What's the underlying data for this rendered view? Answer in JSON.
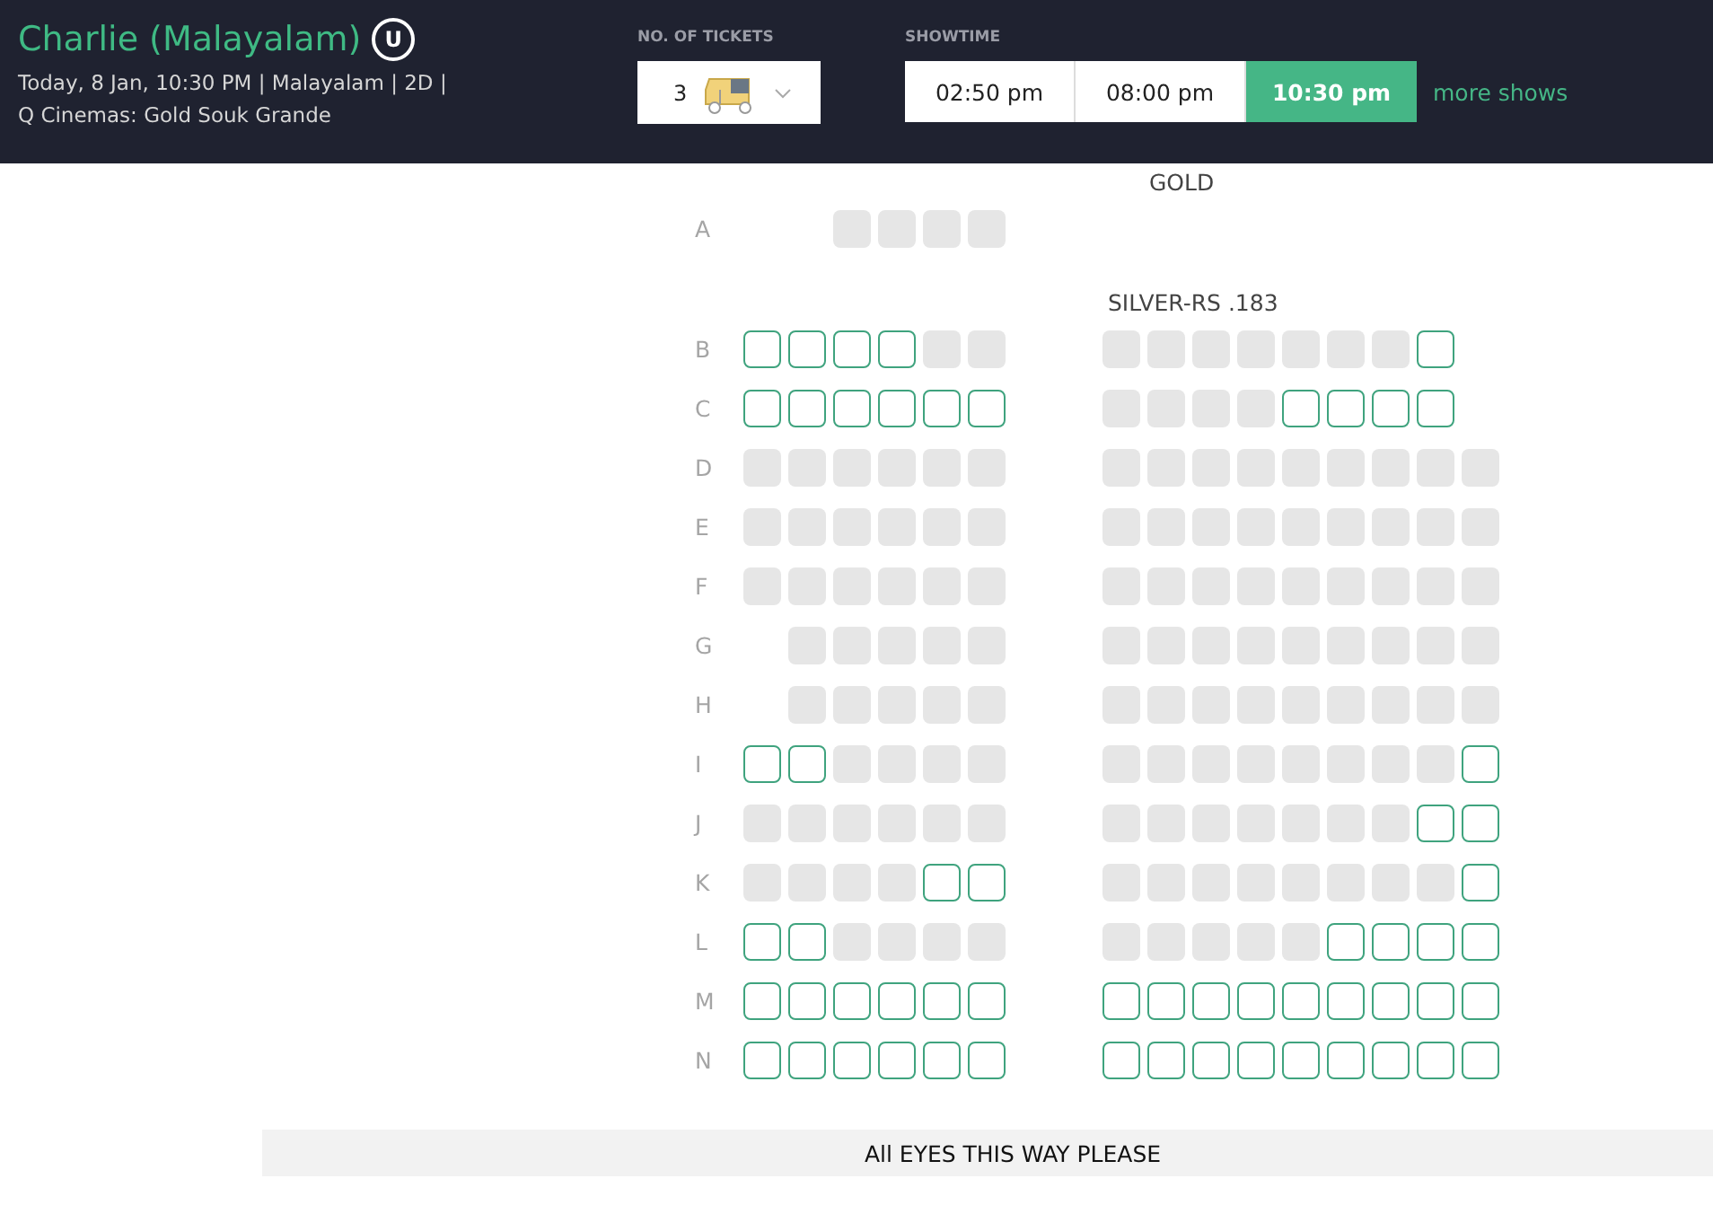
{
  "movie": {
    "title": "Charlie (Malayalam)",
    "certificate": "U",
    "details": "Today, 8 Jan, 10:30 PM | Malayalam | 2D |",
    "cinema": "Q Cinemas: Gold Souk Grande"
  },
  "tickets": {
    "label": "NO. OF TICKETS",
    "value": "3"
  },
  "showtime": {
    "label": "SHOWTIME",
    "times": [
      {
        "label": "02:50 pm",
        "selected": false
      },
      {
        "label": "08:00 pm",
        "selected": false
      },
      {
        "label": "10:30 pm",
        "selected": true
      }
    ],
    "more": "more shows"
  },
  "sections": [
    {
      "title": "GOLD",
      "rows": [
        {
          "label": "A",
          "left": [
            {
              "kind": "gap"
            },
            {
              "kind": "gap"
            },
            {
              "kind": "sold"
            },
            {
              "kind": "sold"
            },
            {
              "kind": "sold"
            },
            {
              "kind": "sold"
            }
          ],
          "right": []
        }
      ]
    },
    {
      "title": "SILVER-RS .183",
      "rows": [
        {
          "label": "B",
          "left": [
            {
              "kind": "available"
            },
            {
              "kind": "available"
            },
            {
              "kind": "available"
            },
            {
              "kind": "available"
            },
            {
              "kind": "sold"
            },
            {
              "kind": "sold"
            }
          ],
          "right": [
            {
              "kind": "sold"
            },
            {
              "kind": "sold"
            },
            {
              "kind": "sold"
            },
            {
              "kind": "sold"
            },
            {
              "kind": "sold"
            },
            {
              "kind": "sold"
            },
            {
              "kind": "sold"
            },
            {
              "kind": "available"
            }
          ]
        },
        {
          "label": "C",
          "left": [
            {
              "kind": "available"
            },
            {
              "kind": "available"
            },
            {
              "kind": "available"
            },
            {
              "kind": "available"
            },
            {
              "kind": "available"
            },
            {
              "kind": "available"
            }
          ],
          "right": [
            {
              "kind": "sold"
            },
            {
              "kind": "sold"
            },
            {
              "kind": "sold"
            },
            {
              "kind": "sold"
            },
            {
              "kind": "available"
            },
            {
              "kind": "available"
            },
            {
              "kind": "available"
            },
            {
              "kind": "available"
            }
          ]
        },
        {
          "label": "D",
          "left": [
            {
              "kind": "sold"
            },
            {
              "kind": "sold"
            },
            {
              "kind": "sold"
            },
            {
              "kind": "sold"
            },
            {
              "kind": "sold"
            },
            {
              "kind": "sold"
            }
          ],
          "right": [
            {
              "kind": "sold"
            },
            {
              "kind": "sold"
            },
            {
              "kind": "sold"
            },
            {
              "kind": "sold"
            },
            {
              "kind": "sold"
            },
            {
              "kind": "sold"
            },
            {
              "kind": "sold"
            },
            {
              "kind": "sold"
            },
            {
              "kind": "sold"
            }
          ]
        },
        {
          "label": "E",
          "left": [
            {
              "kind": "sold"
            },
            {
              "kind": "sold"
            },
            {
              "kind": "sold"
            },
            {
              "kind": "sold"
            },
            {
              "kind": "sold"
            },
            {
              "kind": "sold"
            }
          ],
          "right": [
            {
              "kind": "sold"
            },
            {
              "kind": "sold"
            },
            {
              "kind": "sold"
            },
            {
              "kind": "sold"
            },
            {
              "kind": "sold"
            },
            {
              "kind": "sold"
            },
            {
              "kind": "sold"
            },
            {
              "kind": "sold"
            },
            {
              "kind": "sold"
            }
          ]
        },
        {
          "label": "F",
          "left": [
            {
              "kind": "sold"
            },
            {
              "kind": "sold"
            },
            {
              "kind": "sold"
            },
            {
              "kind": "sold"
            },
            {
              "kind": "sold"
            },
            {
              "kind": "sold"
            }
          ],
          "right": [
            {
              "kind": "sold"
            },
            {
              "kind": "sold"
            },
            {
              "kind": "sold"
            },
            {
              "kind": "sold"
            },
            {
              "kind": "sold"
            },
            {
              "kind": "sold"
            },
            {
              "kind": "sold"
            },
            {
              "kind": "sold"
            },
            {
              "kind": "sold"
            }
          ]
        },
        {
          "label": "G",
          "left": [
            {
              "kind": "gap"
            },
            {
              "kind": "sold"
            },
            {
              "kind": "sold"
            },
            {
              "kind": "sold"
            },
            {
              "kind": "sold"
            },
            {
              "kind": "sold"
            }
          ],
          "right": [
            {
              "kind": "sold"
            },
            {
              "kind": "sold"
            },
            {
              "kind": "sold"
            },
            {
              "kind": "sold"
            },
            {
              "kind": "sold"
            },
            {
              "kind": "sold"
            },
            {
              "kind": "sold"
            },
            {
              "kind": "sold"
            },
            {
              "kind": "sold"
            }
          ]
        },
        {
          "label": "H",
          "left": [
            {
              "kind": "gap"
            },
            {
              "kind": "sold"
            },
            {
              "kind": "sold"
            },
            {
              "kind": "sold"
            },
            {
              "kind": "sold"
            },
            {
              "kind": "sold"
            }
          ],
          "right": [
            {
              "kind": "sold"
            },
            {
              "kind": "sold"
            },
            {
              "kind": "sold"
            },
            {
              "kind": "sold"
            },
            {
              "kind": "sold"
            },
            {
              "kind": "sold"
            },
            {
              "kind": "sold"
            },
            {
              "kind": "sold"
            },
            {
              "kind": "sold"
            }
          ]
        },
        {
          "label": "I",
          "left": [
            {
              "kind": "available"
            },
            {
              "kind": "available"
            },
            {
              "kind": "sold"
            },
            {
              "kind": "sold"
            },
            {
              "kind": "sold"
            },
            {
              "kind": "sold"
            }
          ],
          "right": [
            {
              "kind": "sold"
            },
            {
              "kind": "sold"
            },
            {
              "kind": "sold"
            },
            {
              "kind": "sold"
            },
            {
              "kind": "sold"
            },
            {
              "kind": "sold"
            },
            {
              "kind": "sold"
            },
            {
              "kind": "sold"
            },
            {
              "kind": "available"
            }
          ]
        },
        {
          "label": "J",
          "left": [
            {
              "kind": "sold"
            },
            {
              "kind": "sold"
            },
            {
              "kind": "sold"
            },
            {
              "kind": "sold"
            },
            {
              "kind": "sold"
            },
            {
              "kind": "sold"
            }
          ],
          "right": [
            {
              "kind": "sold"
            },
            {
              "kind": "sold"
            },
            {
              "kind": "sold"
            },
            {
              "kind": "sold"
            },
            {
              "kind": "sold"
            },
            {
              "kind": "sold"
            },
            {
              "kind": "sold"
            },
            {
              "kind": "available"
            },
            {
              "kind": "available"
            }
          ]
        },
        {
          "label": "K",
          "left": [
            {
              "kind": "sold"
            },
            {
              "kind": "sold"
            },
            {
              "kind": "sold"
            },
            {
              "kind": "sold"
            },
            {
              "kind": "available"
            },
            {
              "kind": "available"
            }
          ],
          "right": [
            {
              "kind": "sold"
            },
            {
              "kind": "sold"
            },
            {
              "kind": "sold"
            },
            {
              "kind": "sold"
            },
            {
              "kind": "sold"
            },
            {
              "kind": "sold"
            },
            {
              "kind": "sold"
            },
            {
              "kind": "sold"
            },
            {
              "kind": "available"
            }
          ]
        },
        {
          "label": "L",
          "left": [
            {
              "kind": "available"
            },
            {
              "kind": "available"
            },
            {
              "kind": "sold"
            },
            {
              "kind": "sold"
            },
            {
              "kind": "sold"
            },
            {
              "kind": "sold"
            }
          ],
          "right": [
            {
              "kind": "sold"
            },
            {
              "kind": "sold"
            },
            {
              "kind": "sold"
            },
            {
              "kind": "sold"
            },
            {
              "kind": "sold"
            },
            {
              "kind": "available"
            },
            {
              "kind": "available"
            },
            {
              "kind": "available"
            },
            {
              "kind": "available"
            }
          ]
        },
        {
          "label": "M",
          "left": [
            {
              "kind": "available"
            },
            {
              "kind": "available"
            },
            {
              "kind": "available"
            },
            {
              "kind": "available"
            },
            {
              "kind": "available"
            },
            {
              "kind": "available"
            }
          ],
          "right": [
            {
              "kind": "available"
            },
            {
              "kind": "available"
            },
            {
              "kind": "available"
            },
            {
              "kind": "available"
            },
            {
              "kind": "available"
            },
            {
              "kind": "available"
            },
            {
              "kind": "available"
            },
            {
              "kind": "available"
            },
            {
              "kind": "available"
            }
          ]
        },
        {
          "label": "N",
          "left": [
            {
              "kind": "available"
            },
            {
              "kind": "available"
            },
            {
              "kind": "available"
            },
            {
              "kind": "available"
            },
            {
              "kind": "available"
            },
            {
              "kind": "available"
            }
          ],
          "right": [
            {
              "kind": "available"
            },
            {
              "kind": "available"
            },
            {
              "kind": "available"
            },
            {
              "kind": "available"
            },
            {
              "kind": "available"
            },
            {
              "kind": "available"
            },
            {
              "kind": "available"
            },
            {
              "kind": "available"
            },
            {
              "kind": "available"
            }
          ]
        }
      ]
    }
  ],
  "screen": {
    "label": "All EYES THIS WAY PLEASE"
  }
}
